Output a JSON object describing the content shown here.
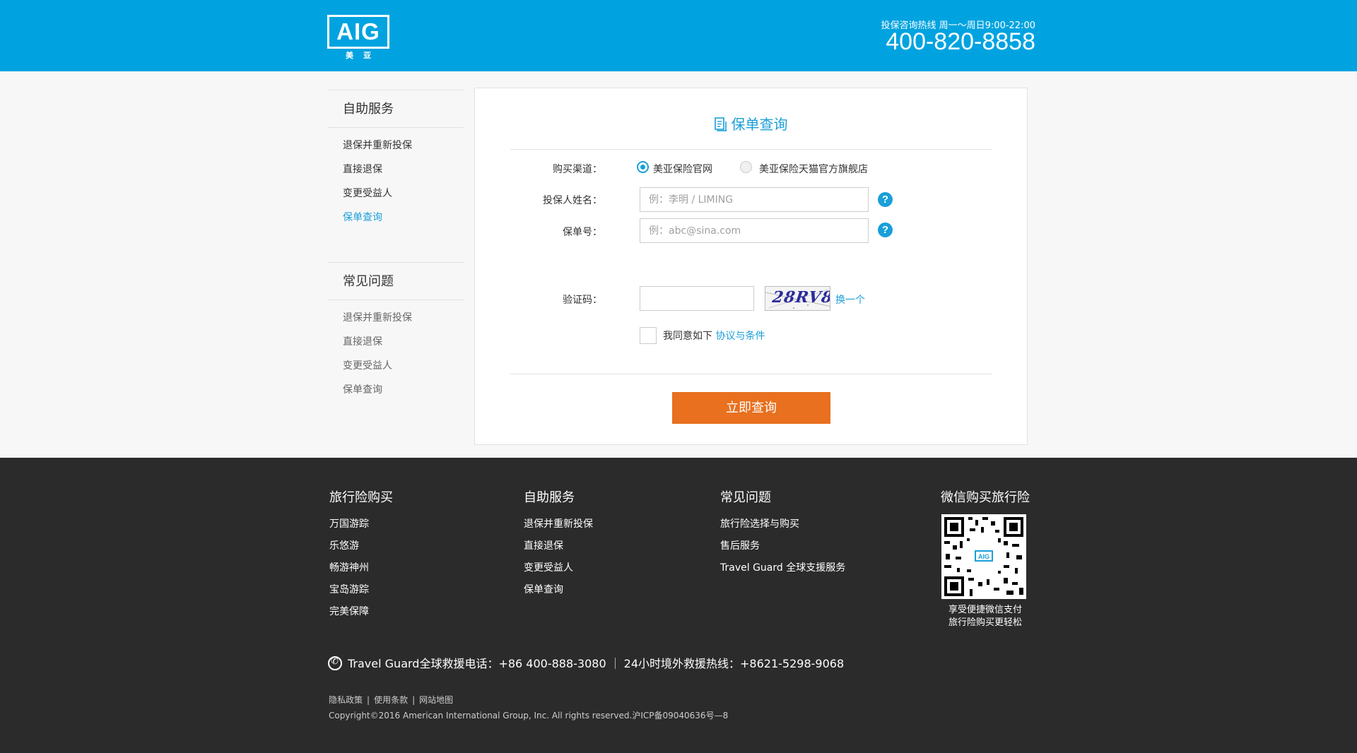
{
  "header": {
    "logo_text": "AIG",
    "logo_sub": "美亚",
    "hotline_label": "投保咨询热线 周一～周日9:00-22:00",
    "hotline_number": "400-820-8858"
  },
  "sidebar": {
    "self_service": {
      "title": "自助服务",
      "items": [
        "退保并重新投保",
        "直接退保",
        "变更受益人",
        "保单查询"
      ]
    },
    "faq": {
      "title": "常见问题",
      "items": [
        "退保并重新投保",
        "直接退保",
        "变更受益人",
        "保单查询"
      ]
    }
  },
  "form": {
    "title": "保单查询",
    "channel_label": "购买渠道：",
    "channel_options": [
      "美亚保险官网",
      "美亚保险天猫官方旗舰店"
    ],
    "selected_channel": "美亚保险官网",
    "name_label": "投保人姓名：",
    "name_placeholder": "例：李明 / LIMING",
    "policy_label": "保单号：",
    "policy_placeholder": "例：abc@sina.com",
    "captcha_label": "验证码：",
    "captcha_value": "",
    "captcha_image_text": "28RV8",
    "refresh_label": "换一个",
    "agree_text": "我同意如下",
    "agree_link": "协议与条件",
    "submit_label": "立即查询",
    "accent_color": "#1a9fd9",
    "button_color": "#e8701f"
  },
  "footer": {
    "col1": {
      "title": "旅行险购买",
      "links": [
        "万国游踪",
        "乐悠游",
        "畅游神州",
        "宝岛游踪",
        "完美保障"
      ]
    },
    "col2": {
      "title": "自助服务",
      "links": [
        "退保并重新投保",
        "直接退保",
        "变更受益人",
        "保单查询"
      ]
    },
    "col3": {
      "title": "常见问题",
      "links": [
        "旅行险选择与购买",
        "售后服务",
        "Travel Guard 全球支援服务"
      ]
    },
    "wechat": {
      "title": "微信购买旅行险",
      "caption_line1": "享受便捷微信支付",
      "caption_line2": "旅行险购买更轻松"
    },
    "hotline_global": "Travel Guard全球救援电话：+86 400-888-3080",
    "hotline_overseas": "24小时境外救援热线：+8621-5298-9068",
    "legal_links": [
      "隐私政策",
      "使用条款",
      "网站地图"
    ],
    "copyright": "Copyright©2016 American International Group, Inc. All rights reserved.沪ICP备09040636号—8"
  },
  "colors": {
    "header_bg": "#00a3e0",
    "footer_bg": "#2b2b2b",
    "page_bg": "#f7f7f7"
  }
}
